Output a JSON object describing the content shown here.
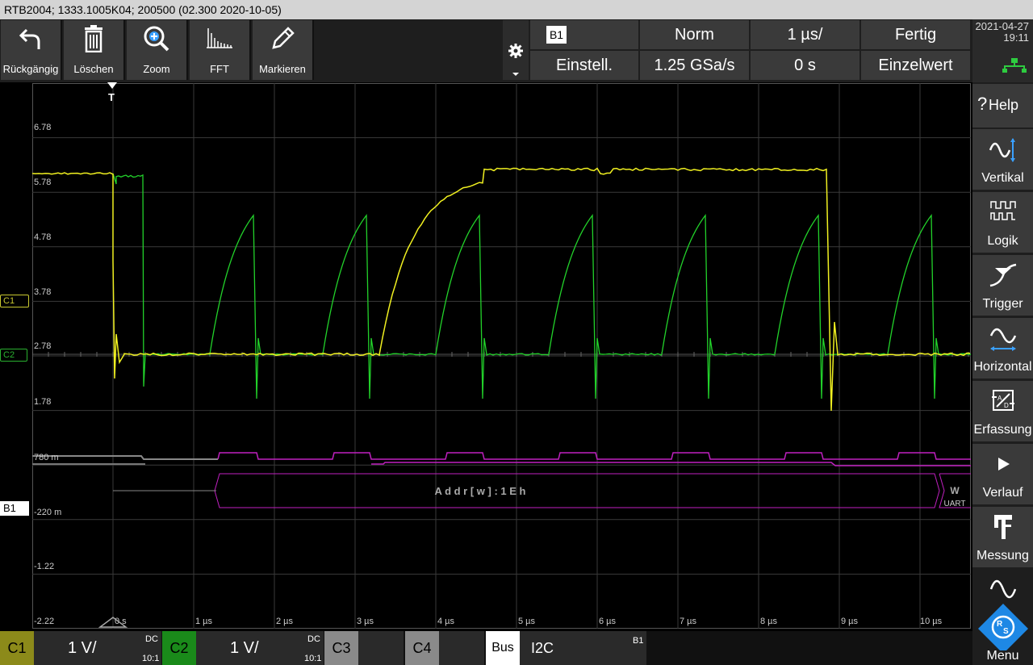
{
  "title": "RTB2004; 1333.1005K04; 200500 (02.300 2020-10-05)",
  "toolbar": {
    "undo": "Rückgängig",
    "delete": "Löschen",
    "zoom": "Zoom",
    "fft": "FFT",
    "mark": "Markieren"
  },
  "header": {
    "bus_badge": "B1",
    "trigger_mode": "Norm",
    "timebase": "1 µs/",
    "status": "Fertig",
    "settings": "Einstell.",
    "sample_rate": "1.25 GSa/s",
    "position": "0 s",
    "acq_mode": "Einzelwert"
  },
  "clock": {
    "date": "2021-04-27",
    "time": "19:11"
  },
  "side_menu": [
    "Help",
    "Vertikal",
    "Logik",
    "Trigger",
    "Horizontal",
    "Erfassung",
    "Verlauf",
    "Messung",
    "Menu"
  ],
  "y_axis_upper": [
    "6.78",
    "5.78",
    "4.78",
    "3.78",
    "2.78",
    "1.78"
  ],
  "y_axis_lower": [
    "780 m",
    "-220 m",
    "-1.22",
    "-2.22"
  ],
  "x_axis": [
    "0 s",
    "1 µs",
    "2 µs",
    "3 µs",
    "4 µs",
    "5 µs",
    "6 µs",
    "7 µs",
    "8 µs",
    "9 µs",
    "10 µs"
  ],
  "markers": {
    "c1": "C1",
    "c2": "C2",
    "b1": "B1",
    "trigger": "T"
  },
  "decode": {
    "text": "A d d r [ w ] : 1 E h",
    "tail": "W",
    "tail_sub": "UART"
  },
  "bottom": {
    "c1_label": "C1",
    "c1_scale": "1 V/",
    "c1_coupling": "DC",
    "c1_probe": "10:1",
    "c2_label": "C2",
    "c2_scale": "1 V/",
    "c2_coupling": "DC",
    "c2_probe": "10:1",
    "c3_label": "C3",
    "c4_label": "C4",
    "bus_label": "Bus",
    "bus_protocol": "I2C",
    "bus_id": "B1"
  },
  "colors": {
    "c1": "#f0f020",
    "c2": "#22d22a",
    "bus": "#c020c0"
  }
}
